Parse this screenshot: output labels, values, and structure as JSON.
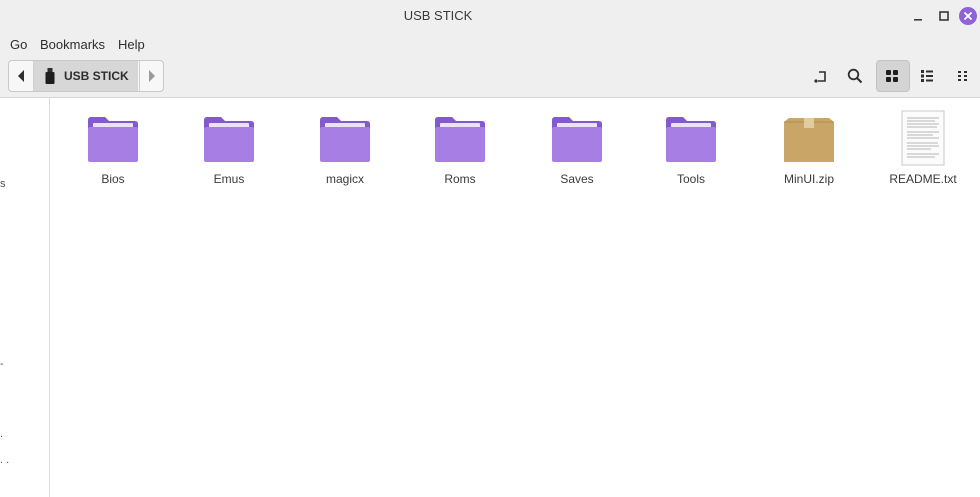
{
  "window": {
    "title": "USB STICK"
  },
  "menu": {
    "items": [
      "Go",
      "Bookmarks",
      "Help"
    ]
  },
  "pathbar": {
    "current": "USB STICK"
  },
  "sidebar": {
    "fragments": [
      "s",
      "-",
      ".",
      ". ."
    ]
  },
  "files": [
    {
      "name": "Bios",
      "type": "folder"
    },
    {
      "name": "Emus",
      "type": "folder"
    },
    {
      "name": "magicx",
      "type": "folder"
    },
    {
      "name": "Roms",
      "type": "folder"
    },
    {
      "name": "Saves",
      "type": "folder"
    },
    {
      "name": "Tools",
      "type": "folder"
    },
    {
      "name": "MinUI.zip",
      "type": "archive"
    },
    {
      "name": "README.txt",
      "type": "text"
    }
  ],
  "colors": {
    "folder": "#a67ee4",
    "folder_tab": "#8458cf",
    "archive": "#c9a567",
    "close_button": "#8e62d8",
    "toolbar_bg": "#efefef"
  },
  "icons": [
    "folder-icon",
    "archive-icon",
    "text-file-icon",
    "usb-drive-icon",
    "search-icon",
    "grid-view-icon",
    "list-view-icon",
    "compact-view-icon",
    "open-location-icon"
  ]
}
